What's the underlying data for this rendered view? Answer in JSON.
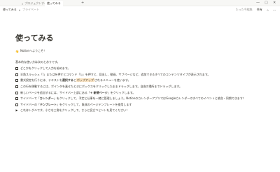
{
  "tabs": [
    {
      "label": "プロジェクトすべての"
    },
    {
      "label": "使ってみる"
    }
  ],
  "window": {
    "minimize": "—",
    "maximize": "▢",
    "close": "✕"
  },
  "breadcrumb": {
    "title": "使ってみる",
    "privacy": "プライベート"
  },
  "toolbar": {
    "edited": "たった今編集",
    "share": "共有",
    "more": "···"
  },
  "page": {
    "title": "使ってみる",
    "welcome_emoji": "👋",
    "welcome": "Notionへようこそ！",
    "intro": "基本的な使い方は次のとおりです。",
    "todos": [
      {
        "type": "check",
        "parts": [
          {
            "t": "どこかをクリックして入力を始めます。"
          }
        ]
      },
      {
        "type": "check",
        "parts": [
          {
            "t": "半角スラッシュ「/」またはを押すとコマンド「/」」を押すと、見出し、動画、サブページなど、追加できるすべてのコンテンツタイプが表示されます。"
          }
        ]
      },
      {
        "type": "check",
        "parts": [
          {
            "t": "書式設定を行うには、テキストを"
          },
          {
            "t": "選択する",
            "b": true
          },
          {
            "t": "と"
          },
          {
            "t": "ポップアップ",
            "hl": true
          },
          {
            "t": "されるメニューを使います。"
          }
        ]
      },
      {
        "type": "check",
        "parts": [
          {
            "t": "この行を移動するには、ポインタを乗せたときにボックスをクリックしたままドラッグします。自由の場所までドラッグします。"
          }
        ]
      },
      {
        "type": "check",
        "parts": [
          {
            "t": "新しいページを追加するには、サイドバー上部にある「"
          },
          {
            "t": "+ 新規ページ",
            "b": true
          },
          {
            "t": "」をクリックします。"
          }
        ]
      },
      {
        "type": "check",
        "parts": [
          {
            "t": "サイドバーで「"
          },
          {
            "t": "カレンダー",
            "b": true
          },
          {
            "t": "」をクリックして、予定と仕事を一緒に管理しましょう。NotionのカレンダーアプリではGoogleカレンダーのすべてのイベントと統合・同期できます！"
          }
        ]
      },
      {
        "type": "check",
        "parts": [
          {
            "t": "サイドバーの「"
          },
          {
            "t": "テンプレート",
            "b": true
          },
          {
            "t": "」をクリックして、既成のページテンプレートを使用します"
          }
        ]
      },
      {
        "type": "toggle",
        "parts": [
          {
            "t": "これはトグルです。小さな三角をクリックして、さらに役立つヒントを見てください！"
          }
        ]
      }
    ]
  }
}
